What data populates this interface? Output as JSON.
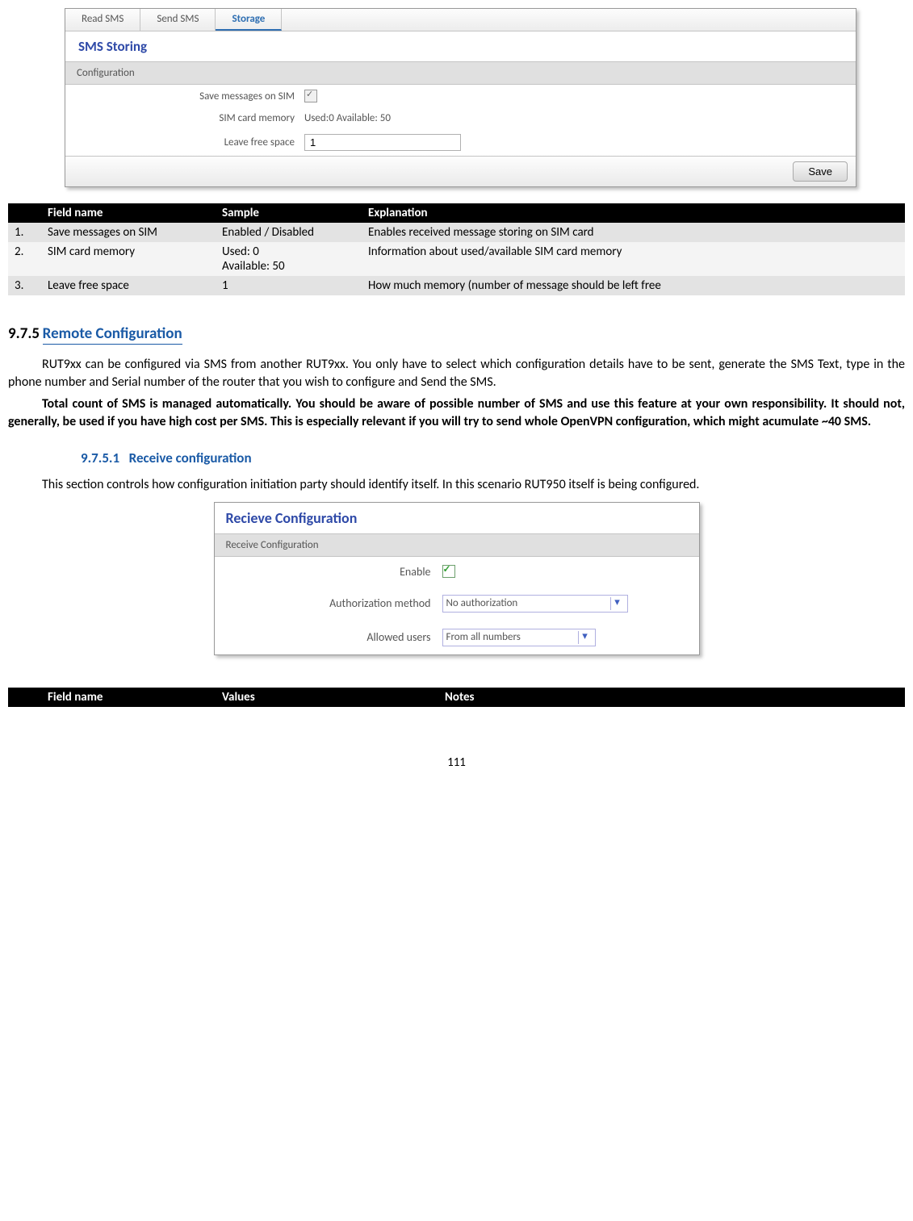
{
  "sms_panel": {
    "tabs": [
      "Read SMS",
      "Send SMS",
      "Storage"
    ],
    "active_tab": 2,
    "title": "SMS Storing",
    "section": "Configuration",
    "save_on_sim_label": "Save messages on SIM",
    "sim_mem_label": "SIM card memory",
    "sim_mem_value": "Used:0 Available: 50",
    "leave_free_label": "Leave free space",
    "leave_free_value": "1",
    "save_btn": "Save"
  },
  "table1": {
    "headers": [
      "",
      "Field name",
      "Sample",
      "Explanation"
    ],
    "rows": [
      {
        "n": "1.",
        "name": "Save messages on SIM",
        "sample": "Enabled / Disabled",
        "exp": "Enables received message storing on SIM card"
      },
      {
        "n": "2.",
        "name": "SIM card memory",
        "sample": "Used: 0\nAvailable: 50",
        "exp": "Information about used/available SIM card memory"
      },
      {
        "n": "3.",
        "name": "Leave free space",
        "sample": "1",
        "exp": "How much memory (number of message should be left free"
      }
    ]
  },
  "sec975": {
    "num": "9.7.5",
    "title": "Remote Configuration",
    "p1": "RUT9xx can be configured via SMS from another RUT9xx. You only have to select which configuration details have to be sent, generate the SMS Text, type in the phone number and Serial number of the router that you wish to configure and Send the SMS.",
    "p2": "Total count of SMS is managed automatically. You should be aware of possible number of SMS and use this feature at your own responsibility. It should not, generally, be used if you have high cost per SMS. This is especially relevant if you will try to send whole OpenVPN configuration, which might acumulate ~40 SMS."
  },
  "sec9751": {
    "num": "9.7.5.1",
    "title": "Receive configuration",
    "p": "This section controls how configuration initiation party should identify itself. In this scenario RUT950 itself is being configured."
  },
  "recv_panel": {
    "title": "Recieve Configuration",
    "section": "Receive Configuration",
    "enable_label": "Enable",
    "auth_label": "Authorization method",
    "auth_value": "No authorization",
    "allowed_label": "Allowed users",
    "allowed_value": "From all numbers"
  },
  "table2": {
    "headers": [
      "",
      "Field name",
      "Values",
      "Notes"
    ]
  },
  "page_number": "111"
}
